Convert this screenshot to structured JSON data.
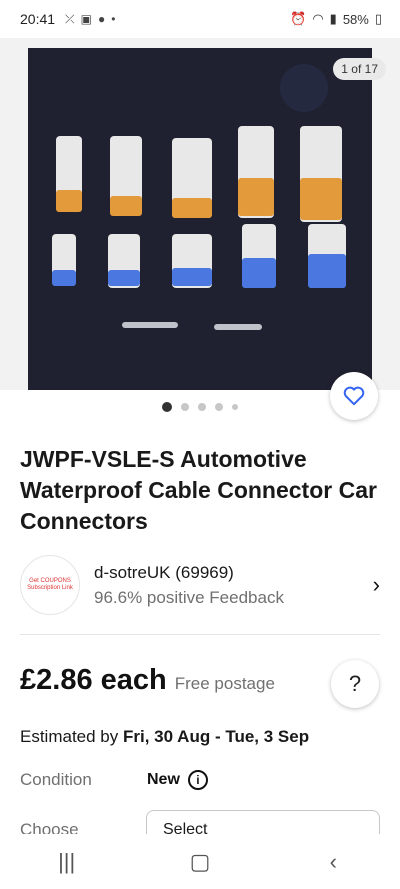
{
  "status_bar": {
    "time": "20:41",
    "battery": "58%"
  },
  "gallery": {
    "counter": "1 of 17",
    "page_count": 5,
    "active_index": 0
  },
  "listing": {
    "title": "JWPF-VSLE-S Automotive Waterproof Cable Connector Car Connectors"
  },
  "seller": {
    "avatar_text": "Get COUPONS Subscription Link",
    "name": "d-sotreUK (69969)",
    "feedback": "96.6% positive Feedback"
  },
  "price": {
    "amount": "£2.86 each",
    "postage": "Free postage"
  },
  "delivery": {
    "prefix": "Estimated by ",
    "dates": "Fri, 30 Aug - Tue, 3 Sep"
  },
  "condition": {
    "label": "Condition",
    "value": "New"
  },
  "choose": {
    "label": "Choose",
    "select_text": "Select"
  },
  "colors": {
    "accent": "#3665f3",
    "connector_orange": "#e39a3b",
    "connector_blue": "#4a78e0"
  },
  "icons": {
    "watch": "heart-icon",
    "help": "question-icon",
    "seller": "chevron-right-icon",
    "condition_info": "info-icon"
  }
}
